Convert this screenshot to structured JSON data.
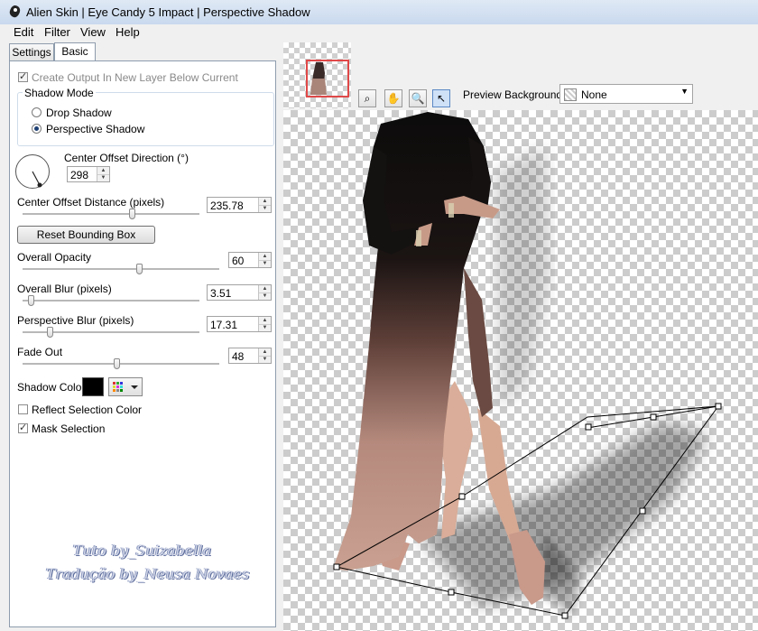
{
  "window": {
    "title": "Alien Skin | Eye Candy 5 Impact | Perspective Shadow"
  },
  "menu": [
    "Edit",
    "Filter",
    "View",
    "Help"
  ],
  "tabs": {
    "settings": "Settings",
    "basic": "Basic"
  },
  "panel": {
    "create_output": "Create Output In New Layer Below Current",
    "shadow_mode": {
      "title": "Shadow Mode",
      "drop": "Drop Shadow",
      "perspective": "Perspective Shadow",
      "selected": "Perspective Shadow"
    },
    "center_offset_direction": {
      "label": "Center Offset Direction (°)",
      "value": "298"
    },
    "center_offset_distance": {
      "label": "Center Offset Distance (pixels)",
      "value": "235.78"
    },
    "reset_button": "Reset Bounding Box",
    "overall_opacity": {
      "label": "Overall Opacity",
      "value": "60"
    },
    "overall_blur": {
      "label": "Overall Blur (pixels)",
      "value": "3.51"
    },
    "perspective_blur": {
      "label": "Perspective Blur (pixels)",
      "value": "17.31"
    },
    "fade_out": {
      "label": "Fade Out",
      "value": "48"
    },
    "shadow_color": {
      "label": "Shadow Color",
      "color": "#000000"
    },
    "reflect_selection_color": {
      "label": "Reflect Selection Color",
      "checked": false
    },
    "mask_selection": {
      "label": "Mask Selection",
      "checked": true
    },
    "watermark": [
      "Tuto by_Suizabella",
      "Tradução by_Neusa Novaes"
    ]
  },
  "toolbar": {
    "tools": [
      "zoom-fit-icon",
      "hand-icon",
      "magnifier-icon",
      "arrow-pointer-icon"
    ],
    "preview_background_label": "Preview Background:",
    "preview_background_value": "None"
  },
  "colors": {
    "accent": "#1d3f73",
    "thumb_frame": "#e04848"
  }
}
